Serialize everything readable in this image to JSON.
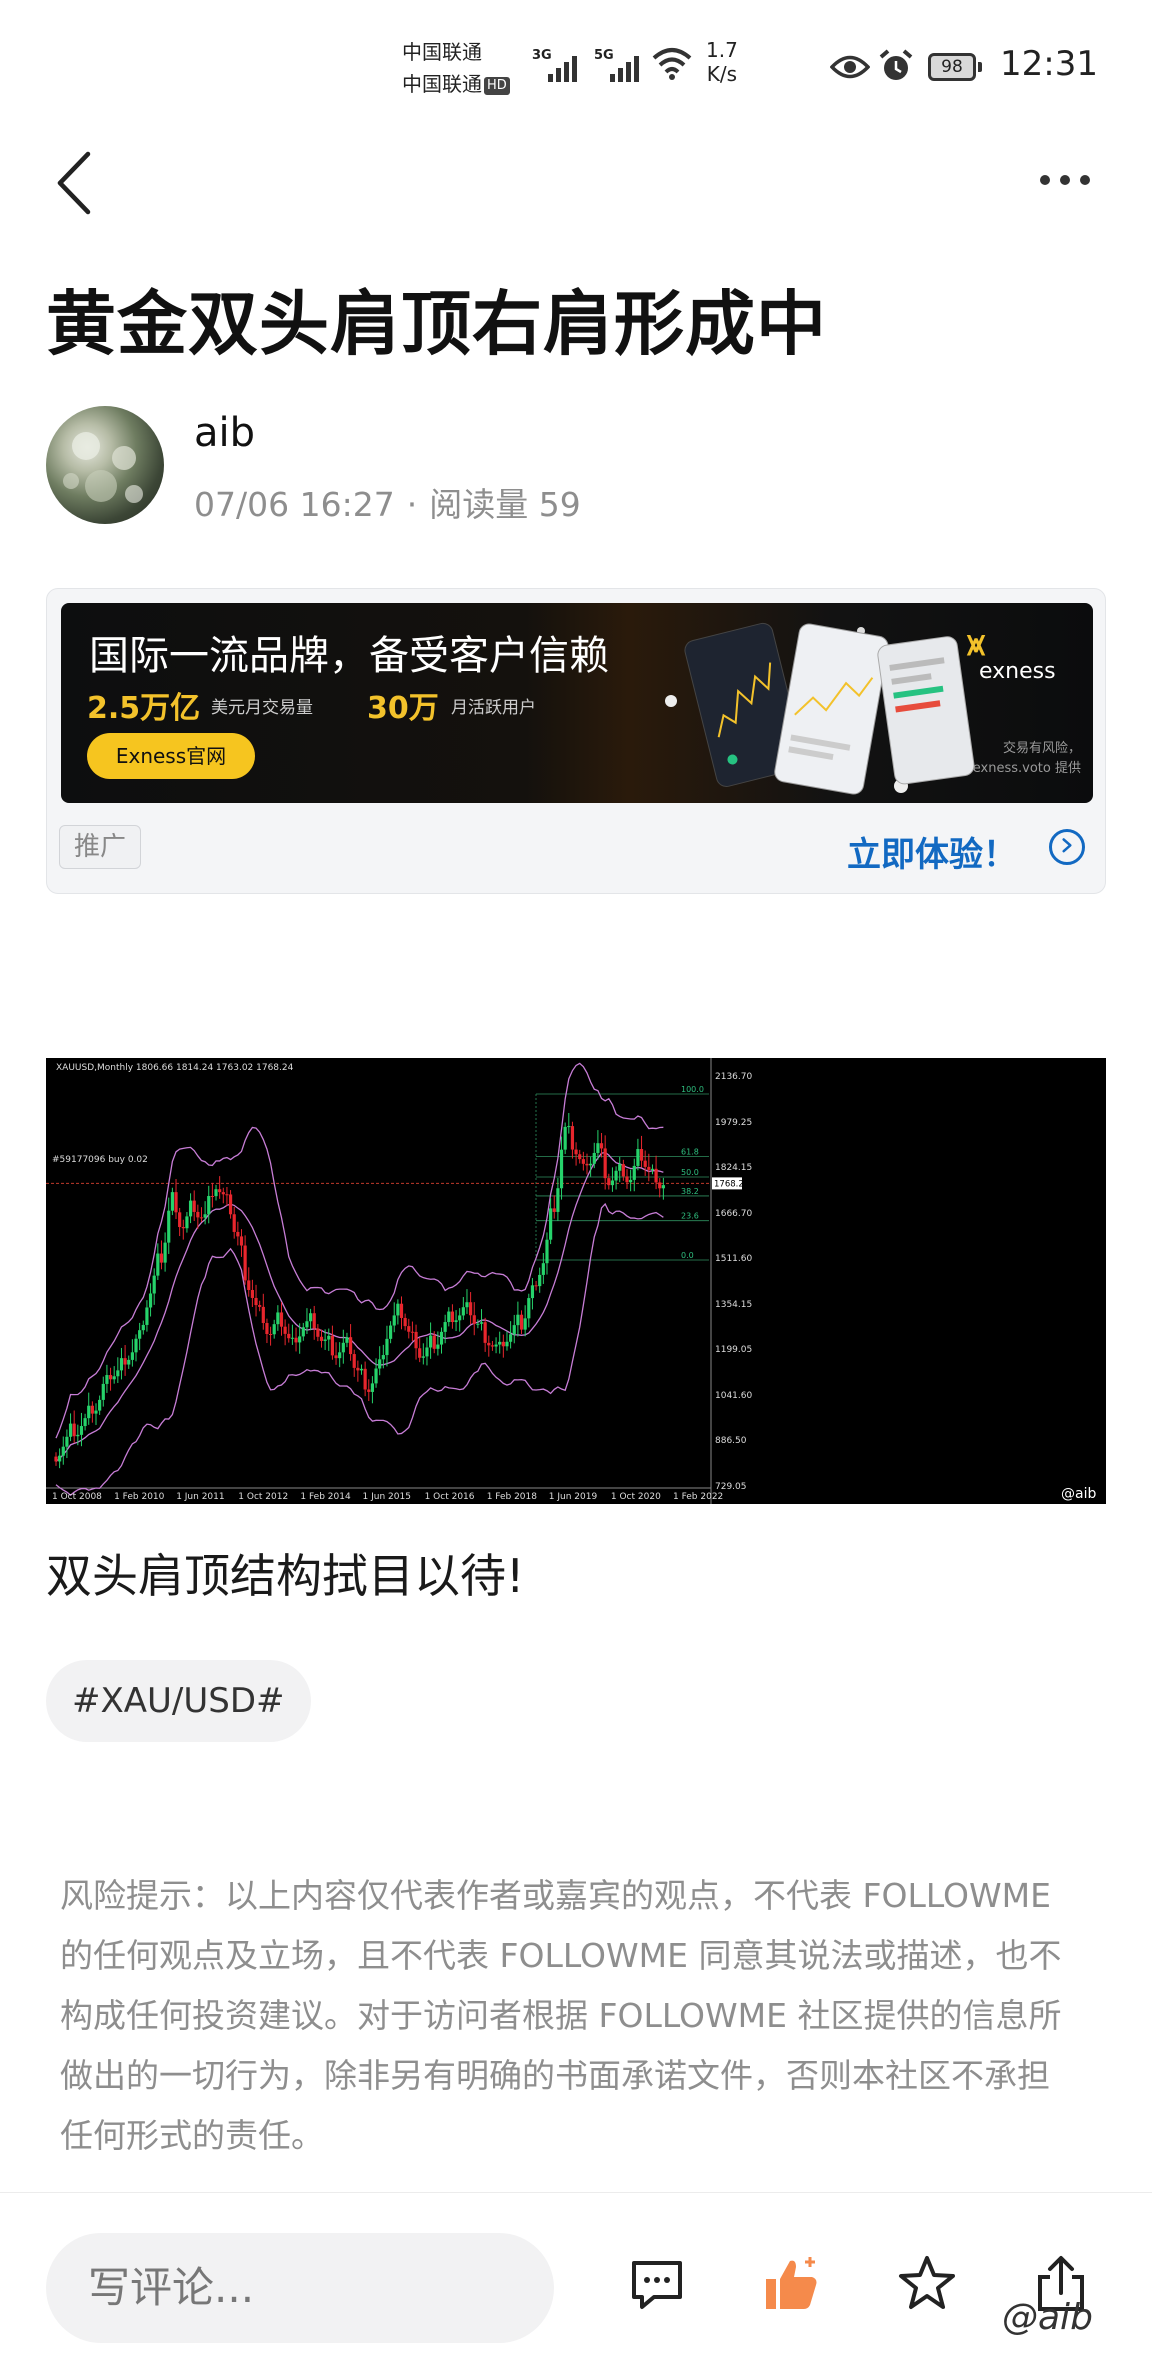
{
  "status_bar": {
    "carrier1": "中国联通",
    "carrier2": "中国联通",
    "hd": "HD",
    "net1": "3G",
    "net2": "5G",
    "speed_value": "1.7",
    "speed_unit": "K/s",
    "battery": "98",
    "time": "12:31"
  },
  "article": {
    "title": "黄金双头肩顶右肩形成中",
    "author": "aib",
    "date": "07/06 16:27",
    "separator": "·",
    "views": "阅读量 59",
    "caption": "双头肩顶结构拭目以待!",
    "tag": "#XAU/USD#",
    "risk_notice": "风险提示：以上内容仅代表作者或嘉宾的观点，不代表 FOLLOWME 的任何观点及立场，且不代表 FOLLOWME 同意其说法或描述，也不构成任何投资建议。对于访问者根据 FOLLOWME 社区提供的信息所做出的一切行为，除非另有明确的书面承诺文件，否则本社区不承担任何形式的责任。"
  },
  "ad": {
    "headline": "国际一流品牌，备受客户信赖",
    "stat1_value": "2.5万亿",
    "stat1_label": "美元月交易量",
    "stat2_value": "30万",
    "stat2_label": "月活跃用户",
    "button": "Exness官网",
    "brand": "exness",
    "risk_line1": "交易有风险，",
    "risk_line2": "exness.voto 提供",
    "tag": "推广",
    "cta": "立即体验！"
  },
  "chart_data": {
    "type": "candlestick",
    "title": "XAUUSD,Monthly  1806.66 1814.24 1763.02 1768.24",
    "current_price_label": "1768.24",
    "line_label": "#59177096 buy 0.02",
    "y_ticks": [
      "2136.70",
      "1979.25",
      "1824.15",
      "1666.70",
      "1511.60",
      "1354.15",
      "1199.05",
      "1041.60",
      "886.50",
      "729.05"
    ],
    "x_ticks": [
      "1 Oct 2008",
      "1 Feb 2010",
      "1 Jun 2011",
      "1 Oct 2012",
      "1 Feb 2014",
      "1 Jun 2015",
      "1 Oct 2016",
      "1 Feb 2018",
      "1 Jun 2019",
      "1 Oct 2020",
      "1 Feb 2022"
    ],
    "fib_levels": [
      {
        "label": "100.0",
        "value": 2075
      },
      {
        "label": "61.8",
        "value": 1860
      },
      {
        "label": "50.0",
        "value": 1790
      },
      {
        "label": "38.2",
        "value": 1725
      },
      {
        "label": "23.6",
        "value": 1640
      },
      {
        "label": "0.0",
        "value": 1505
      }
    ],
    "ylim": [
      729.05,
      2136.7
    ],
    "close_series": [
      870,
      930,
      950,
      1000,
      1080,
      1120,
      1180,
      1240,
      1390,
      1520,
      1720,
      1620,
      1700,
      1650,
      1760,
      1700,
      1580,
      1420,
      1320,
      1250,
      1300,
      1220,
      1280,
      1300,
      1220,
      1180,
      1210,
      1120,
      1070,
      1140,
      1280,
      1330,
      1240,
      1180,
      1230,
      1280,
      1310,
      1330,
      1280,
      1230,
      1200,
      1250,
      1290,
      1400,
      1500,
      1700,
      1950,
      1880,
      1800,
      1900,
      1780,
      1810,
      1780,
      1870,
      1800,
      1768
    ],
    "watermark": "@aib"
  },
  "bottom_bar": {
    "comment_placeholder": "写评论...",
    "watermark": "@aib"
  }
}
